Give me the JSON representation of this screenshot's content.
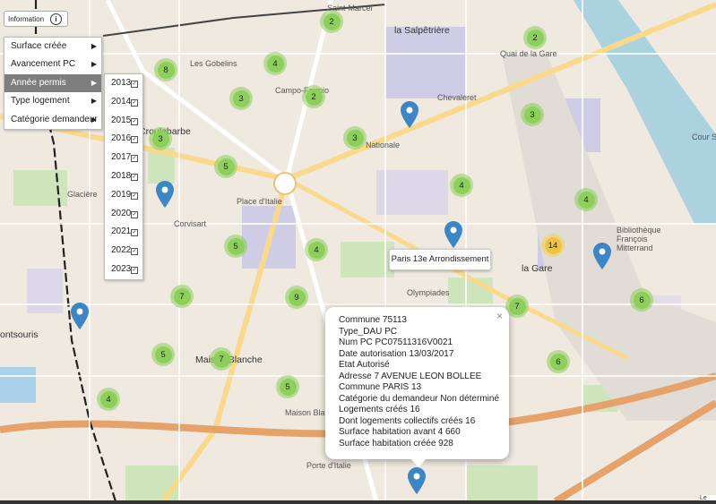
{
  "map": {
    "place_labels": [
      {
        "id": "saint-marcel",
        "text": "Saint-Marcel"
      },
      {
        "id": "salpetriere",
        "text": "la Salpêtrière"
      },
      {
        "id": "quai-gare",
        "text": "Quai de la Gare"
      },
      {
        "id": "gobelins",
        "text": "Les Gobelins"
      },
      {
        "id": "campo-formio",
        "text": "Campo-Formio"
      },
      {
        "id": "chevaleret",
        "text": "Chevaleret"
      },
      {
        "id": "croulebarbe",
        "text": "Croulebarbe"
      },
      {
        "id": "nationale",
        "text": "Nationale"
      },
      {
        "id": "glaciere",
        "text": "Glacière"
      },
      {
        "id": "place-italie",
        "text": "Place d'Italie"
      },
      {
        "id": "corvisart",
        "text": "Corvisart"
      },
      {
        "id": "bibliotheque",
        "text": "Bibliothèque François Mitterrand"
      },
      {
        "id": "la-gare",
        "text": "la Gare"
      },
      {
        "id": "olympiades",
        "text": "Olympiades"
      },
      {
        "id": "montsouris",
        "text": "ontsouris"
      },
      {
        "id": "maison-blanche",
        "text": "Maison Blanche"
      },
      {
        "id": "maison-blanc-st",
        "text": "Maison Blanc"
      },
      {
        "id": "porte-italie",
        "text": "Porte d'Italie"
      },
      {
        "id": "cour-seine",
        "text": "Cour Se"
      }
    ],
    "clusters": [
      {
        "id": "c1",
        "count": "2",
        "color": "green"
      },
      {
        "id": "c2",
        "count": "2",
        "color": "green"
      },
      {
        "id": "c3",
        "count": "8",
        "color": "green"
      },
      {
        "id": "c4",
        "count": "4",
        "color": "green"
      },
      {
        "id": "c5",
        "count": "3",
        "color": "green"
      },
      {
        "id": "c6",
        "count": "2",
        "color": "green"
      },
      {
        "id": "c7",
        "count": "3",
        "color": "green"
      },
      {
        "id": "c8",
        "count": "3",
        "color": "green"
      },
      {
        "id": "c9",
        "count": "3",
        "color": "green"
      },
      {
        "id": "c10",
        "count": "5",
        "color": "green"
      },
      {
        "id": "c11",
        "count": "4",
        "color": "green"
      },
      {
        "id": "c12",
        "count": "4",
        "color": "green"
      },
      {
        "id": "c13",
        "count": "5",
        "color": "green"
      },
      {
        "id": "c14",
        "count": "4",
        "color": "green"
      },
      {
        "id": "c15",
        "count": "14",
        "color": "yellow"
      },
      {
        "id": "c16",
        "count": "7",
        "color": "green"
      },
      {
        "id": "c17",
        "count": "9",
        "color": "green"
      },
      {
        "id": "c18",
        "count": "7",
        "color": "green"
      },
      {
        "id": "c19",
        "count": "6",
        "color": "green"
      },
      {
        "id": "c20",
        "count": "5",
        "color": "green"
      },
      {
        "id": "c21",
        "count": "7",
        "color": "green"
      },
      {
        "id": "c22",
        "count": "6",
        "color": "green"
      },
      {
        "id": "c23",
        "count": "4",
        "color": "green"
      },
      {
        "id": "c24",
        "count": "5",
        "color": "green"
      }
    ],
    "marker_color": "#3d86c6",
    "cluster_color": "#8cd05a",
    "cluster_large_color": "#f0c43a"
  },
  "info_button": {
    "label": "Information",
    "icon": "info-icon"
  },
  "menu": {
    "items": [
      {
        "label": "Surface créée"
      },
      {
        "label": "Avancement PC"
      },
      {
        "label": "Année permis",
        "active": true
      },
      {
        "label": "Type logement"
      },
      {
        "label": "Catégorie demandeur"
      }
    ]
  },
  "years": {
    "items": [
      {
        "label": "2013",
        "checked": true
      },
      {
        "label": "2014",
        "checked": true
      },
      {
        "label": "2015",
        "checked": true
      },
      {
        "label": "2016",
        "checked": true
      },
      {
        "label": "2017",
        "checked": true
      },
      {
        "label": "2018",
        "checked": true
      },
      {
        "label": "2019",
        "checked": true
      },
      {
        "label": "2020",
        "checked": true
      },
      {
        "label": "2021",
        "checked": true
      },
      {
        "label": "2022",
        "checked": true
      },
      {
        "label": "2023",
        "checked": true
      }
    ]
  },
  "tooltip": {
    "text": "Paris 13e Arrondissement"
  },
  "popup": {
    "close": "×",
    "lines": [
      "Commune 75113",
      "Type_DAU PC",
      "Num PC PC07511316V0021",
      "Date autorisation 13/03/2017",
      "Etat Autorisé",
      "Adresse 7 AVENUE LEON BOLLEE",
      "Commune PARIS 13",
      "Catégorie du demandeur Non déterminé",
      "Logements créés 16",
      "Dont logements collectifs créés 16",
      "Surface habitation avant 4 660",
      "Surface habitation créée 928"
    ]
  },
  "attribution": {
    "text": "Le"
  }
}
